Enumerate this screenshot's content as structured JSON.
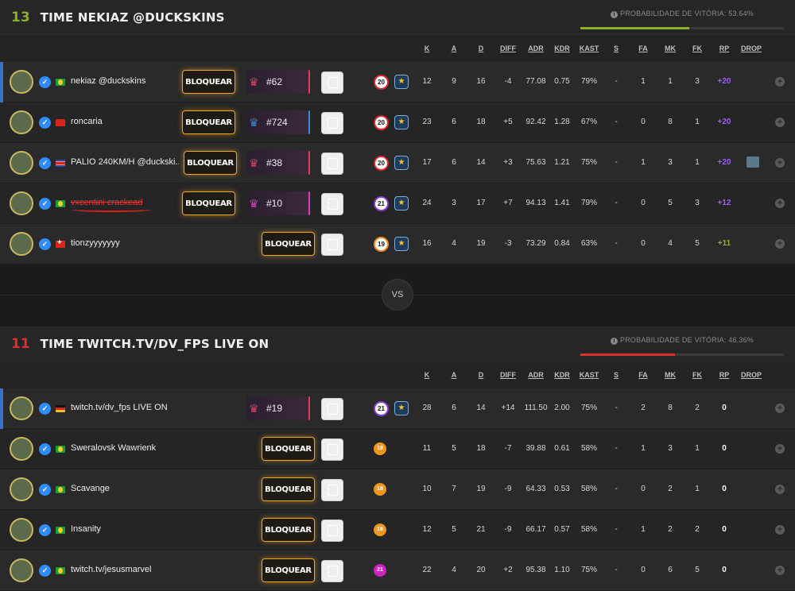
{
  "team1": {
    "score": "13",
    "score_color": "#8fae2a",
    "name": "TIME NEKIAZ @DUCKSKINS",
    "probability_text": "PROBABILIDADE DE VITÓRIA: 53.64%",
    "probability_value": 53.64,
    "probability_color": "#8fae2a",
    "columns": [
      "K",
      "A",
      "D",
      "DIFF",
      "ADR",
      "KDR",
      "KAST",
      "S",
      "FA",
      "MK",
      "FK",
      "RP",
      "DROP"
    ],
    "players": [
      {
        "name": "nekiaz @duckskins",
        "flag": "br",
        "block": "BLOQUEAR",
        "rank": "#62",
        "crown_color": "#e04060",
        "level": "20",
        "level_style": "ring",
        "K": "12",
        "A": "9",
        "D": "16",
        "DIFF": "-4",
        "ADR": "77.08",
        "KDR": "0.75",
        "KAST": "79%",
        "S": "-",
        "FA": "1",
        "MK": "1",
        "FK": "3",
        "RP": "+20",
        "rp_color": "#a05aff"
      },
      {
        "name": "roncaria",
        "flag": "hk",
        "block": "BLOQUEAR",
        "rank": "#724",
        "crown_color": "#3a8ad8",
        "level": "20",
        "level_style": "ring",
        "K": "23",
        "A": "6",
        "D": "18",
        "DIFF": "+5",
        "ADR": "92.42",
        "KDR": "1.28",
        "KAST": "67%",
        "S": "-",
        "FA": "0",
        "MK": "8",
        "FK": "1",
        "RP": "+20",
        "rp_color": "#a05aff"
      },
      {
        "name": "PALIO 240KM/H @duckski...",
        "flag": "kp",
        "block": "BLOQUEAR",
        "rank": "#38",
        "crown_color": "#e04060",
        "level": "20",
        "level_style": "ring",
        "K": "17",
        "A": "6",
        "D": "14",
        "DIFF": "+3",
        "ADR": "75.63",
        "KDR": "1.21",
        "KAST": "75%",
        "S": "-",
        "FA": "1",
        "MK": "3",
        "FK": "1",
        "RP": "+20",
        "rp_color": "#a05aff"
      },
      {
        "name": "vxcentini crackead",
        "flag": "br",
        "block": "BLOQUEAR",
        "rank": "#10",
        "crown_color": "#d040c0",
        "level": "21",
        "level_style": "multi",
        "K": "24",
        "A": "3",
        "D": "17",
        "DIFF": "+7",
        "ADR": "94.13",
        "KDR": "1.41",
        "KAST": "79%",
        "S": "-",
        "FA": "0",
        "MK": "5",
        "FK": "3",
        "RP": "+12",
        "rp_color": "#a05aff"
      },
      {
        "name": "tionzyyyyyyy",
        "flag": "ch",
        "block": "BLOQUEAR",
        "rank": "",
        "crown_color": "",
        "level": "19",
        "level_style": "ring-orange",
        "K": "16",
        "A": "4",
        "D": "19",
        "DIFF": "-3",
        "ADR": "73.29",
        "KDR": "0.84",
        "KAST": "63%",
        "S": "-",
        "FA": "0",
        "MK": "4",
        "FK": "5",
        "RP": "+11",
        "rp_color": "#8fae2a"
      }
    ]
  },
  "vs_label": "VS",
  "team2": {
    "score": "11",
    "score_color": "#d8322c",
    "name": "TIME TWITCH.TV/DV_FPS LIVE ON",
    "probability_text": "PROBABILIDADE DE VITÓRIA: 46.36%",
    "probability_value": 46.36,
    "probability_color": "#d8322c",
    "columns": [
      "K",
      "A",
      "D",
      "DIFF",
      "ADR",
      "KDR",
      "KAST",
      "S",
      "FA",
      "MK",
      "FK",
      "RP",
      "DROP"
    ],
    "players": [
      {
        "name": "twitch.tv/dv_fps LIVE ON",
        "flag": "de",
        "block": "",
        "rank": "#19",
        "crown_color": "#e04060",
        "level": "21",
        "level_style": "multi",
        "K": "28",
        "A": "6",
        "D": "14",
        "DIFF": "+14",
        "ADR": "111.50",
        "KDR": "2.00",
        "KAST": "75%",
        "S": "-",
        "FA": "2",
        "MK": "8",
        "FK": "2",
        "RP": "0",
        "rp_color": "#ffffff"
      },
      {
        "name": "Sweralovsk Wawrienk",
        "flag": "br",
        "block": "BLOQUEAR",
        "rank": "",
        "crown_color": "",
        "level": "19",
        "level_style": "solid-orange",
        "K": "11",
        "A": "5",
        "D": "18",
        "DIFF": "-7",
        "ADR": "39.88",
        "KDR": "0.61",
        "KAST": "58%",
        "S": "-",
        "FA": "1",
        "MK": "3",
        "FK": "1",
        "RP": "0",
        "rp_color": "#ffffff"
      },
      {
        "name": "Scavange",
        "flag": "br",
        "block": "BLOQUEAR",
        "rank": "",
        "crown_color": "",
        "level": "18",
        "level_style": "solid-orange",
        "K": "10",
        "A": "7",
        "D": "19",
        "DIFF": "-9",
        "ADR": "64.33",
        "KDR": "0.53",
        "KAST": "58%",
        "S": "-",
        "FA": "0",
        "MK": "2",
        "FK": "1",
        "RP": "0",
        "rp_color": "#ffffff"
      },
      {
        "name": "Insanity",
        "flag": "br",
        "block": "BLOQUEAR",
        "rank": "",
        "crown_color": "",
        "level": "18",
        "level_style": "solid-orange",
        "K": "12",
        "A": "5",
        "D": "21",
        "DIFF": "-9",
        "ADR": "66.17",
        "KDR": "0.57",
        "KAST": "58%",
        "S": "-",
        "FA": "1",
        "MK": "2",
        "FK": "2",
        "RP": "0",
        "rp_color": "#ffffff"
      },
      {
        "name": "twitch.tv/jesusmarvel",
        "flag": "br",
        "block": "BLOQUEAR",
        "rank": "",
        "crown_color": "",
        "level": "21",
        "level_style": "solid-magenta",
        "K": "22",
        "A": "4",
        "D": "20",
        "DIFF": "+2",
        "ADR": "95.38",
        "KDR": "1.10",
        "KAST": "75%",
        "S": "-",
        "FA": "0",
        "MK": "6",
        "FK": "5",
        "RP": "0",
        "rp_color": "#ffffff"
      }
    ]
  }
}
